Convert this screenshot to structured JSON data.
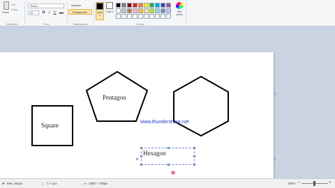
{
  "ribbon": {
    "clipboard": {
      "paste_label": "Paste",
      "cut_label": "Cut",
      "copy_label": "Copy",
      "group_label": "Clipboard"
    },
    "font": {
      "family": "Times",
      "size": "20",
      "group_label": "Font",
      "bold": "B",
      "italic": "I",
      "underline": "U",
      "strike": "abc"
    },
    "background": {
      "opaque_label": "Opaque",
      "transparent_label": "Transparent",
      "group_label": "Background"
    },
    "colors": {
      "color1_label": "Color 1",
      "color2_label": "Color 2",
      "edit_label": "Edit colors",
      "group_label": "Colors",
      "color1": "#000000",
      "color2": "#ffffff",
      "palette": [
        "#000000",
        "#7f7f7f",
        "#880015",
        "#ed1c24",
        "#ff7f27",
        "#fff200",
        "#22b14c",
        "#00a2e8",
        "#3f48cc",
        "#a349a4",
        "#ffffff",
        "#c3c3c3",
        "#b97a57",
        "#ffaec9",
        "#ffc90e",
        "#efe4b0",
        "#b5e61d",
        "#99d9ea",
        "#7092be",
        "#c8bfe7",
        "#ffffff",
        "#ffffff",
        "#ffffff",
        "#ffffff",
        "#ffffff",
        "#ffffff",
        "#ffffff",
        "#ffffff",
        "#ffffff",
        "#ffffff"
      ]
    }
  },
  "canvas": {
    "square_label": "Square",
    "pentagon_label": "Pentagon",
    "url_text": "www.thundershare.net",
    "hexagon_label": "Hexagon"
  },
  "status": {
    "cursor_pos": "659, 462px",
    "selection_size": "1 × 1px",
    "image_size": "1580 × 768px",
    "zoom": "100%"
  }
}
